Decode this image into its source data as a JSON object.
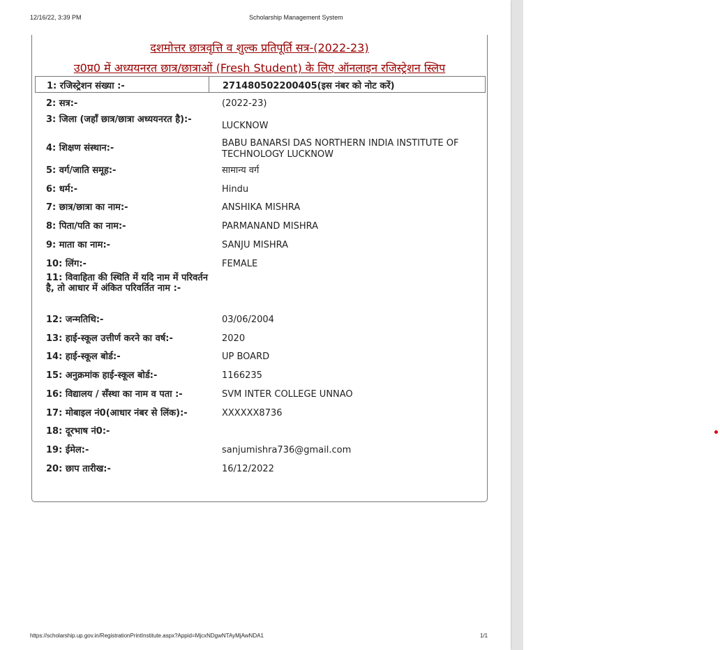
{
  "print_header": {
    "date_time": "12/16/22, 3:39 PM",
    "site_title": "Scholarship Management System"
  },
  "print_footer": {
    "url": "https://scholarship.up.gov.in/RegistrationPrintInstitute.aspx?Appid=MjcxNDgwNTAyMjAwNDA1",
    "page": "1/1"
  },
  "slip": {
    "title_line1": "दशमोत्तर छात्रवृत्ति व शुल्क प्रतिपूर्ति सत्र-(2022-23)",
    "title_line2": "उ0प्र0 में अध्ययनरत छात्र/छात्राओं (Fresh Student) के लिए ऑनलाइन रजिस्ट्रेशन स्लिप",
    "registration": {
      "label": "1: रजिस्ट्रेशन संख्या :-",
      "value": "271480502200405(इस नंबर को नोट करें)"
    },
    "fields": [
      {
        "label": "2: सत्र:-",
        "value": "(2022-23)"
      },
      {
        "label": "3: जिला (जहाँ छात्र/छात्रा अध्ययनरत है):-",
        "value": "LUCKNOW"
      },
      {
        "label": "4: शिक्षण संस्थान:-",
        "value": "BABU BANARSI DAS NORTHERN INDIA INSTITUTE OF TECHNOLOGY LUCKNOW"
      },
      {
        "label": "5: वर्ग/जाति समूह:-",
        "value": "सामान्य वर्ग"
      },
      {
        "label": "6: धर्म:-",
        "value": "Hindu"
      },
      {
        "label": "7: छात्र/छात्रा का नाम:-",
        "value": "ANSHIKA MISHRA"
      },
      {
        "label": "8: पिता/पति का नाम:-",
        "value": "PARMANAND MISHRA"
      },
      {
        "label": "9: माता का नाम:-",
        "value": "SANJU MISHRA"
      },
      {
        "label": "10: लिंग:-",
        "value": "FEMALE"
      },
      {
        "label": "11: विवाहिता की स्थिति में यदि नाम में परिवर्तन है, तो आधार में अंकित परिवर्तित नाम :-",
        "value": ""
      },
      {
        "label": "12: जन्मतिथि:-",
        "value": "03/06/2004"
      },
      {
        "label": "13: हाई-स्कूल उत्तीर्ण करने का वर्ष:-",
        "value": "2020"
      },
      {
        "label": "14: हाई-स्कूल बोर्ड:-",
        "value": "UP BOARD"
      },
      {
        "label": "15: अनुक्रमांक हाई-स्कूल बोर्ड:-",
        "value": "1166235"
      },
      {
        "label": "16: विद्यालय / सँस्था का नाम व पता :-",
        "value": "SVM INTER COLLEGE UNNAO"
      },
      {
        "label": "17: मोबाइल नं0(आधार नंबर से लिंक):-",
        "value": "XXXXXX8736"
      },
      {
        "label": "18: दूरभाष नं0:-",
        "value": ""
      },
      {
        "label": "19: ईमेल:-",
        "value": "sanjumishra736@gmail.com"
      },
      {
        "label": "20: छाप तारीख:-",
        "value": "16/12/2022"
      }
    ]
  }
}
